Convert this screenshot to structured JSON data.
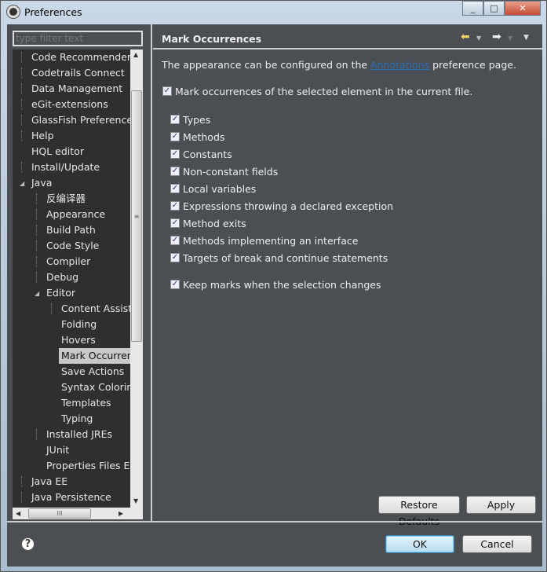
{
  "window": {
    "title": "Preferences",
    "controls": [
      "minimize",
      "maximize",
      "close"
    ]
  },
  "sidebar": {
    "filter_placeholder": "type filter text",
    "items": [
      {
        "label": "Code Recommenders",
        "level": 0,
        "state": "collapsed"
      },
      {
        "label": "Codetrails Connect",
        "level": 0,
        "state": "collapsed"
      },
      {
        "label": "Data Management",
        "level": 0,
        "state": "collapsed"
      },
      {
        "label": "eGit-extensions",
        "level": 0,
        "state": "collapsed"
      },
      {
        "label": "GlassFish Preferences",
        "level": 0,
        "state": "collapsed"
      },
      {
        "label": "Help",
        "level": 0,
        "state": "collapsed"
      },
      {
        "label": "HQL editor",
        "level": 0,
        "state": "leaf"
      },
      {
        "label": "Install/Update",
        "level": 0,
        "state": "collapsed"
      },
      {
        "label": "Java",
        "level": 0,
        "state": "expanded"
      },
      {
        "label": "反编译器",
        "level": 1,
        "state": "collapsed"
      },
      {
        "label": "Appearance",
        "level": 1,
        "state": "collapsed"
      },
      {
        "label": "Build Path",
        "level": 1,
        "state": "collapsed"
      },
      {
        "label": "Code Style",
        "level": 1,
        "state": "collapsed"
      },
      {
        "label": "Compiler",
        "level": 1,
        "state": "collapsed"
      },
      {
        "label": "Debug",
        "level": 1,
        "state": "collapsed"
      },
      {
        "label": "Editor",
        "level": 1,
        "state": "expanded"
      },
      {
        "label": "Content Assist",
        "level": 2,
        "state": "collapsed"
      },
      {
        "label": "Folding",
        "level": 2,
        "state": "leaf"
      },
      {
        "label": "Hovers",
        "level": 2,
        "state": "leaf"
      },
      {
        "label": "Mark Occurrences",
        "level": 2,
        "state": "selected"
      },
      {
        "label": "Save Actions",
        "level": 2,
        "state": "leaf"
      },
      {
        "label": "Syntax Coloring",
        "level": 2,
        "state": "leaf"
      },
      {
        "label": "Templates",
        "level": 2,
        "state": "leaf"
      },
      {
        "label": "Typing",
        "level": 2,
        "state": "leaf"
      },
      {
        "label": "Installed JREs",
        "level": 1,
        "state": "collapsed"
      },
      {
        "label": "JUnit",
        "level": 1,
        "state": "leaf"
      },
      {
        "label": "Properties Files Editor",
        "level": 1,
        "state": "leaf"
      },
      {
        "label": "Java EE",
        "level": 0,
        "state": "collapsed"
      },
      {
        "label": "Java Persistence",
        "level": 0,
        "state": "collapsed"
      }
    ]
  },
  "page": {
    "title": "Mark Occurrences",
    "intro_prefix": "The appearance can be configured on the",
    "intro_link": "Annotations",
    "intro_suffix": "preference page.",
    "main_option": {
      "label": "Mark occurrences of the selected element in the current file.",
      "checked": true
    },
    "options": [
      {
        "label": "Types",
        "checked": true
      },
      {
        "label": "Methods",
        "checked": true
      },
      {
        "label": "Constants",
        "checked": true
      },
      {
        "label": "Non-constant fields",
        "checked": true
      },
      {
        "label": "Local variables",
        "checked": true
      },
      {
        "label": "Expressions throwing a declared exception",
        "checked": true
      },
      {
        "label": "Method exits",
        "checked": true
      },
      {
        "label": "Methods implementing an interface",
        "checked": true
      },
      {
        "label": "Targets of break and continue statements",
        "checked": true
      }
    ],
    "keep_option": {
      "label": "Keep marks when the selection changes",
      "checked": true
    },
    "restore_label": "Restore Defaults",
    "apply_label": "Apply"
  },
  "footer": {
    "ok_label": "OK",
    "cancel_label": "Cancel"
  },
  "colors": {
    "background": "#4b4f53",
    "tree_background": "#2d2f31",
    "link": "#2a6db5",
    "back_arrow": "#f0d060"
  }
}
